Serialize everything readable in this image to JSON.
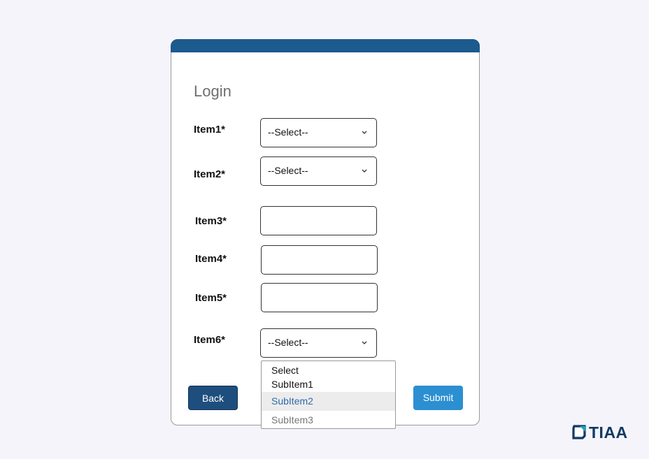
{
  "form": {
    "title": "Login",
    "fields": [
      {
        "label": "Item1*",
        "type": "select",
        "value": "--Select--"
      },
      {
        "label": "Item2*",
        "type": "select",
        "value": "--Select--"
      },
      {
        "label": "Item3*",
        "type": "text",
        "value": ""
      },
      {
        "label": "Item4*",
        "type": "text",
        "value": ""
      },
      {
        "label": "Item5*",
        "type": "text",
        "value": ""
      },
      {
        "label": "Item6*",
        "type": "select",
        "value": "--Select--"
      }
    ],
    "dropdown": {
      "options": [
        "Select",
        "SubItem1",
        "SubItem2",
        "SubItem3"
      ],
      "highlighted": "SubItem2"
    },
    "back_label": "Back",
    "submit_label": "Submit"
  },
  "brand": {
    "logo_text": "TIAA"
  },
  "colors": {
    "header_bar": "#1d5a8e",
    "back_button": "#1e4e7d",
    "submit_button": "#2b8fd2",
    "highlight_bg": "#ececec",
    "highlight_text": "#2f6aa8",
    "logo": "#103a63"
  },
  "icons": [
    "chevron-down-icon",
    "tiaa-logo-icon"
  ]
}
